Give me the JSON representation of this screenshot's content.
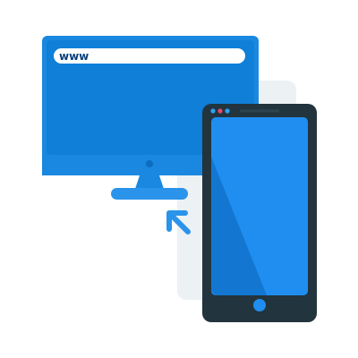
{
  "monitor": {
    "address_text": "www"
  },
  "colors": {
    "monitor_body": "#1a88e0",
    "monitor_screen": "#0d79d2",
    "monitor_bezel": "#0f82dc",
    "address_bar": "#ffffff",
    "address_text": "#0b3f7a",
    "stand": "#2a93ea",
    "overlay_panel": "#e9eef2",
    "phone_body": "#22343d",
    "phone_screen": "#1f8ef0",
    "phone_screen_shade": "#1377d2",
    "phone_button": "#1f8ef0",
    "camera_red": "#e8486b",
    "camera_blue": "#2ea3f2",
    "arrow": "#2a93ea"
  },
  "icons": {
    "monitor": "desktop-monitor-icon",
    "phone": "smartphone-icon",
    "arrow": "arrow-up-left-icon"
  }
}
